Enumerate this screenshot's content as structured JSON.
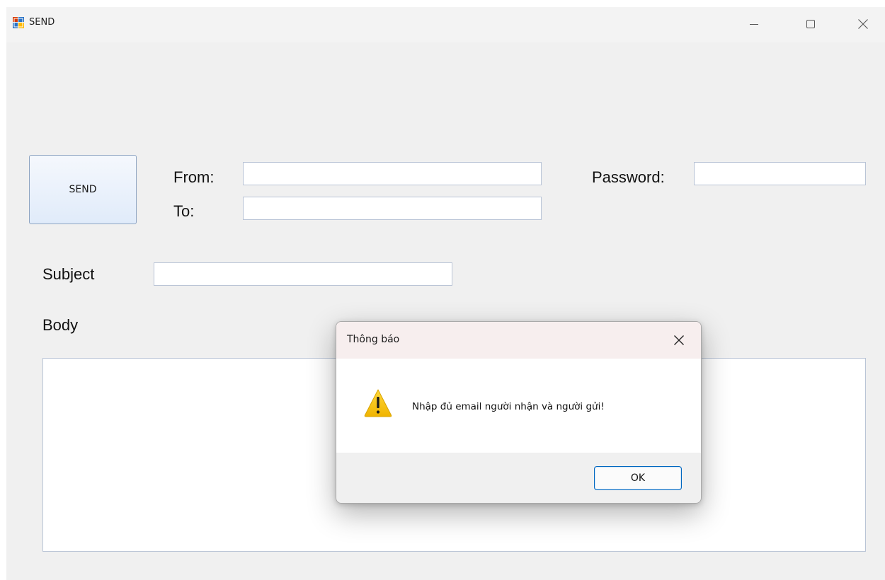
{
  "window": {
    "title": "SEND",
    "controls": {
      "minimize_icon": "minimize-icon",
      "maximize_icon": "maximize-icon",
      "close_icon": "close-icon"
    }
  },
  "form": {
    "send_button_label": "SEND",
    "from_label": "From:",
    "to_label": "To:",
    "password_label": "Password:",
    "subject_label": "Subject",
    "body_label": "Body",
    "from_value": "",
    "to_value": "",
    "password_value": "",
    "subject_value": "",
    "body_value": ""
  },
  "dialog": {
    "title": "Thông báo",
    "message": "Nhập đủ email người nhận và người gửi!",
    "ok_label": "OK",
    "icon": "warning-icon"
  },
  "colors": {
    "window_bg": "#f0f0f0",
    "input_border": "#b9c4d6",
    "ok_border": "#0067c0",
    "warning_yellow": "#f5c400"
  }
}
